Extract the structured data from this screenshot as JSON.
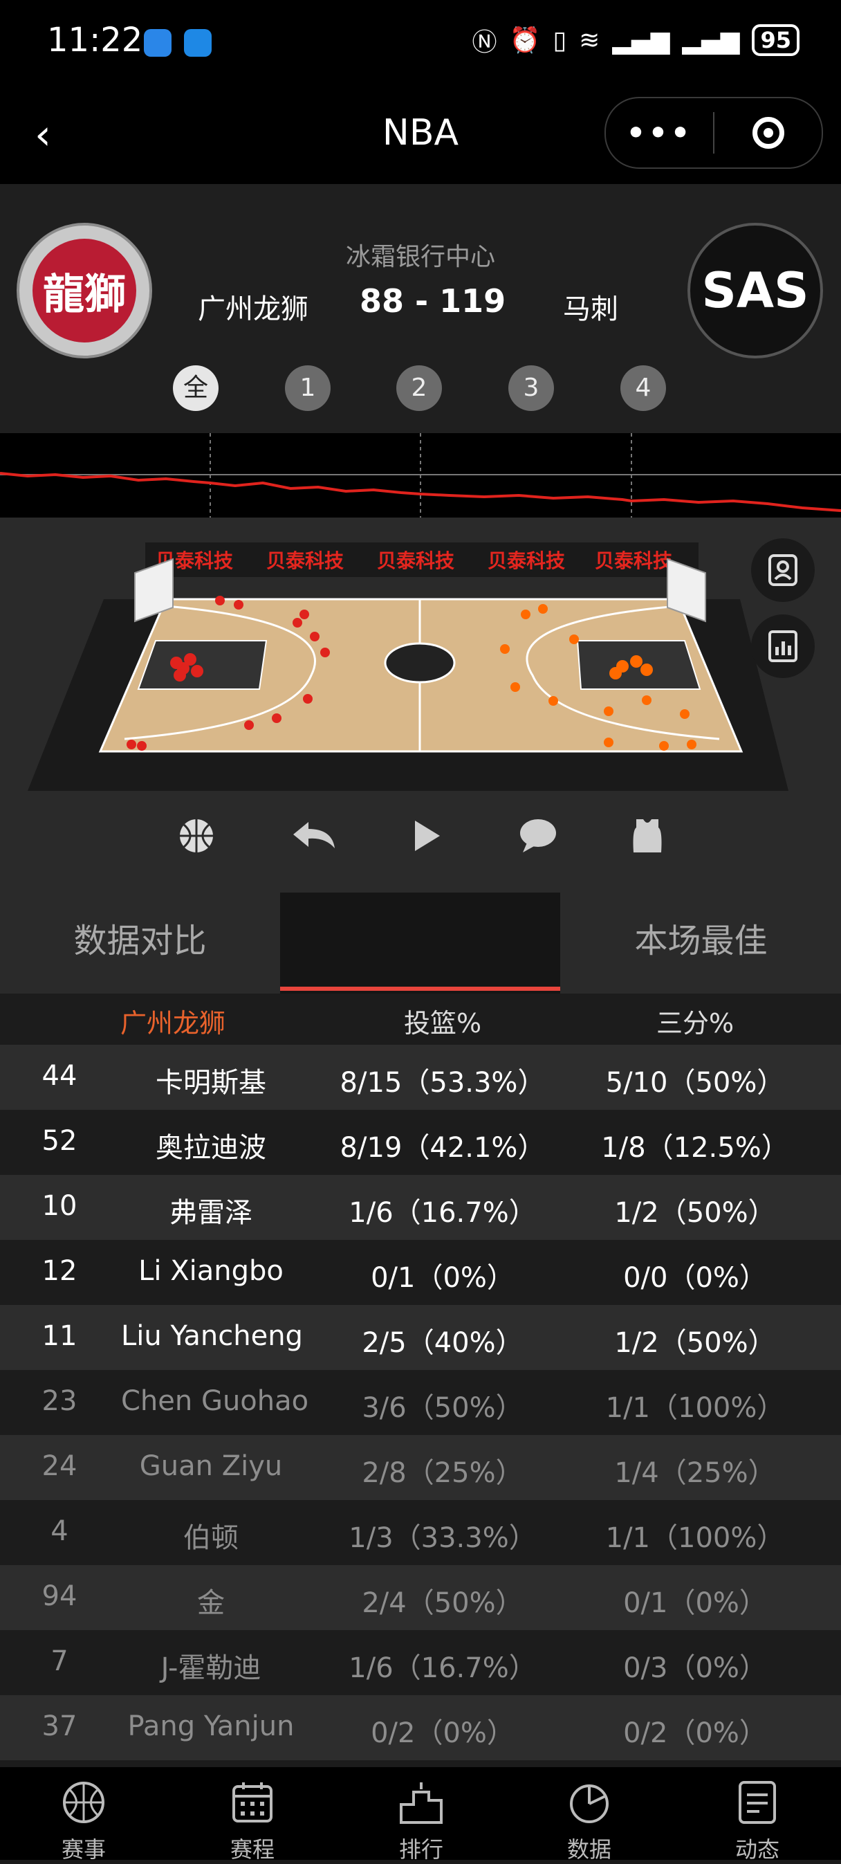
{
  "status_bar": {
    "time": "11:22",
    "battery": "95"
  },
  "nav": {
    "title": "NBA",
    "more": "•••"
  },
  "game": {
    "venue": "冰霜银行中心",
    "home_team": "广州龙狮",
    "home_logo_text": "龍獅",
    "score": "88 - 119",
    "away_team": "马刺",
    "away_logo_text": "SAS",
    "periods": [
      "全",
      "1",
      "2",
      "3",
      "4"
    ],
    "active_period": "全"
  },
  "court": {
    "banner_text": "贝泰科技"
  },
  "tabs": [
    "数据对比",
    "",
    "本场最佳"
  ],
  "table": {
    "headers": {
      "team": "广州龙狮",
      "fg": "投篮%",
      "tp": "三分%"
    },
    "rows": [
      {
        "num": "44",
        "name": "卡明斯基",
        "fg": "8/15（53.3%）",
        "tp": "5/10（50%）"
      },
      {
        "num": "52",
        "name": "奥拉迪波",
        "fg": "8/19（42.1%）",
        "tp": "1/8（12.5%）"
      },
      {
        "num": "10",
        "name": "弗雷泽",
        "fg": "1/6（16.7%）",
        "tp": "1/2（50%）"
      },
      {
        "num": "12",
        "name": "Li Xiangbo",
        "fg": "0/1（0%）",
        "tp": "0/0（0%）"
      },
      {
        "num": "11",
        "name": "Liu Yancheng",
        "fg": "2/5（40%）",
        "tp": "1/2（50%）"
      },
      {
        "num": "23",
        "name": "Chen Guohao",
        "fg": "3/6（50%）",
        "tp": "1/1（100%）"
      },
      {
        "num": "24",
        "name": "Guan Ziyu",
        "fg": "2/8（25%）",
        "tp": "1/4（25%）"
      },
      {
        "num": "4",
        "name": "伯顿",
        "fg": "1/3（33.3%）",
        "tp": "1/1（100%）"
      },
      {
        "num": "94",
        "name": "金",
        "fg": "2/4（50%）",
        "tp": "0/1（0%）"
      },
      {
        "num": "7",
        "name": "J-霍勒迪",
        "fg": "1/6（16.7%）",
        "tp": "0/3（0%）"
      },
      {
        "num": "37",
        "name": "Pang Yanjun",
        "fg": "0/2（0%）",
        "tp": "0/2（0%）"
      }
    ]
  },
  "bottom_nav": [
    "赛事",
    "赛程",
    "排行",
    "数据",
    "动态"
  ],
  "colors": {
    "accent_red": "#e8453c",
    "team_orange": "#e8622c",
    "home_shots": "#e0231d",
    "away_shots": "#ff6a00"
  }
}
